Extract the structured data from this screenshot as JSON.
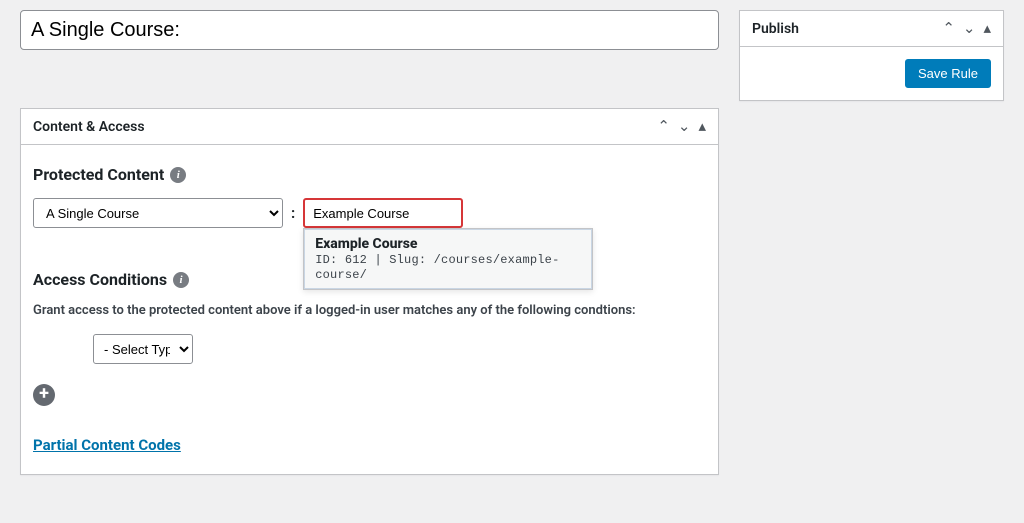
{
  "title": {
    "value": "A Single Course:"
  },
  "publish_box": {
    "heading": "Publish",
    "save_button": "Save Rule"
  },
  "content_box": {
    "heading": "Content & Access",
    "protected_content": {
      "heading": "Protected Content",
      "type_selected": "A Single Course",
      "separator": ":",
      "search_value": "Example Course",
      "dropdown": {
        "title": "Example Course",
        "meta": "ID: 612 | Slug: /courses/example-course/"
      }
    },
    "access_conditions": {
      "heading": "Access Conditions",
      "description": "Grant access to the protected content above if a logged-in user matches any of the following condtions:",
      "type_placeholder": "- Select Type -"
    },
    "partial_link": "Partial Content Codes"
  },
  "icons": {
    "info": "i",
    "plus": "+",
    "up": "▴",
    "down": "▾",
    "toggle": "▴",
    "chev_up": "⌃",
    "chev_down": "⌄"
  }
}
